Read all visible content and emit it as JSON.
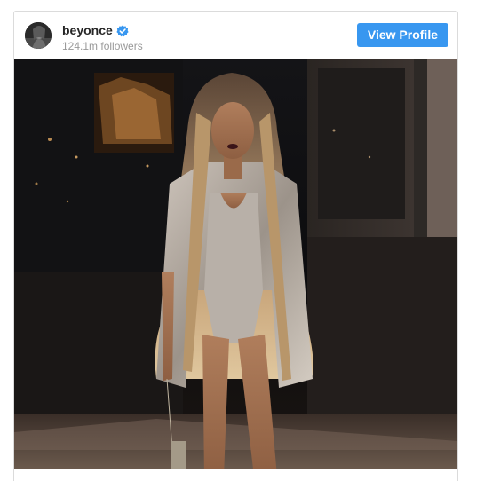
{
  "post": {
    "username": "beyonce",
    "followers": "124.1m followers",
    "view_profile_label": "View Profile",
    "verified_icon": "verified-badge-icon",
    "avatar_icon": "profile-avatar"
  },
  "colors": {
    "button_blue": "#3897f0",
    "verified_blue": "#3897f0",
    "username_text": "#262626",
    "secondary_text": "#999999",
    "border": "#dbdbdb"
  }
}
